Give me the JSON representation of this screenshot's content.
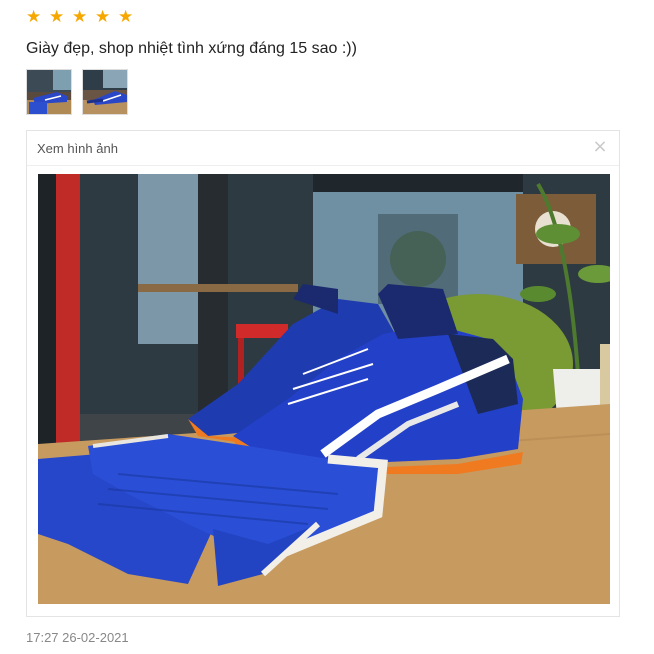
{
  "rating": {
    "stars": 5,
    "max": 5,
    "star_char": "★",
    "color": "#f6a700"
  },
  "review": {
    "text": "Giày đẹp, shop nhiệt tình xứng đáng 15 sao :))"
  },
  "thumbnails": [
    {
      "name": "photo-1"
    },
    {
      "name": "photo-2"
    }
  ],
  "viewer": {
    "title": "Xem hình ảnh",
    "close_icon": "close-icon",
    "close_char": "×"
  },
  "meta": {
    "timestamp": "17:27 26-02-2021"
  }
}
